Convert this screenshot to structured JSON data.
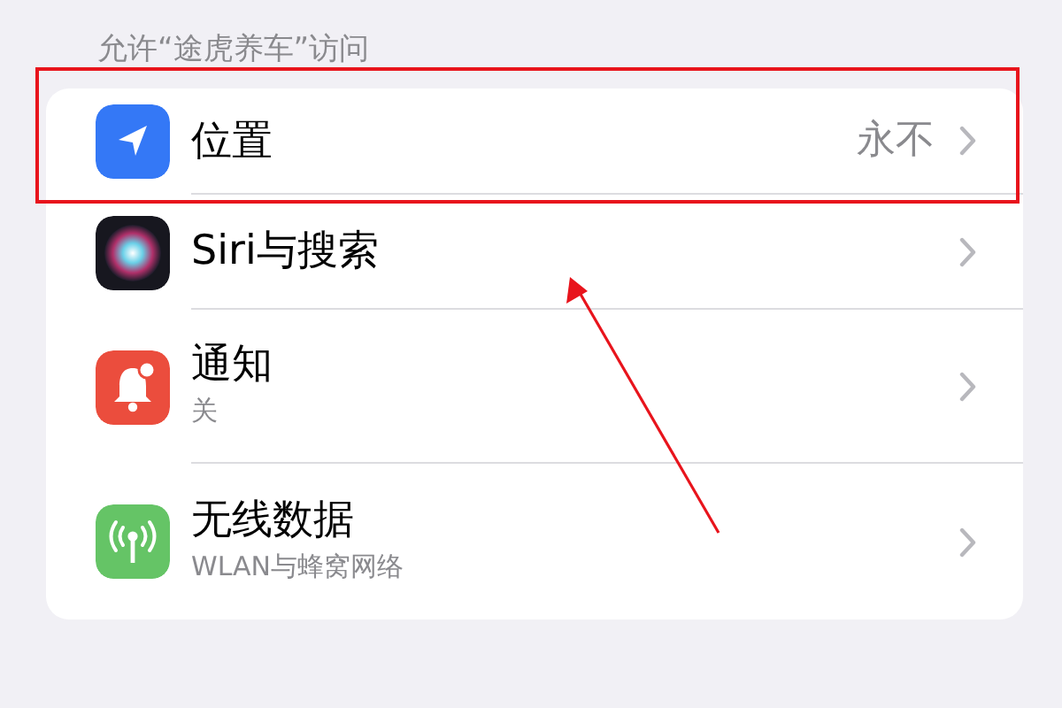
{
  "section_header": "允许“途虎养车”访问",
  "rows": [
    {
      "kind": "location",
      "title": "位置",
      "value": "永不",
      "highlighted": true,
      "arrow_target": false
    },
    {
      "kind": "siri",
      "title": "Siri与搜索",
      "highlighted": false,
      "arrow_target": true
    },
    {
      "kind": "notification",
      "title": "通知",
      "subtitle": "关",
      "highlighted": false,
      "arrow_target": false
    },
    {
      "kind": "cellular",
      "title": "无线数据",
      "subtitle": "WLAN与蜂窝网络",
      "highlighted": false,
      "arrow_target": false
    }
  ]
}
